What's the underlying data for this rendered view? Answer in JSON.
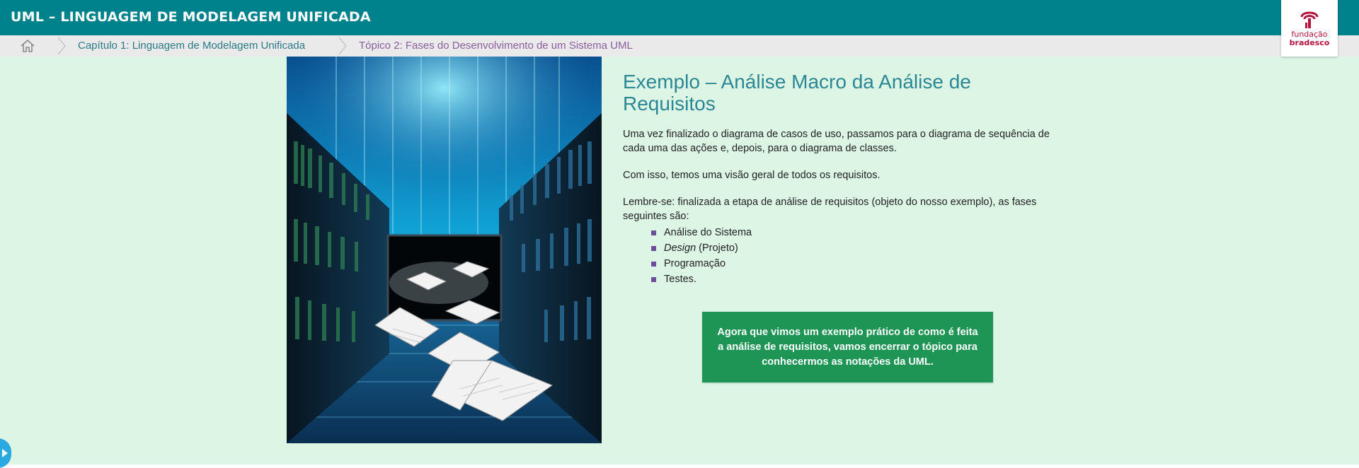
{
  "header": {
    "title": "UML – LINGUAGEM DE MODELAGEM UNIFICADA",
    "logo_line1": "fundação",
    "logo_line2": "bradesco"
  },
  "breadcrumb": {
    "items": [
      {
        "label": "Capítulo 1: Linguagem de Modelagem Unificada"
      },
      {
        "label": "Tópico 2: Fases do Desenvolvimento de um Sistema UML"
      }
    ]
  },
  "main": {
    "heading": "Exemplo – Análise Macro da Análise de Requisitos",
    "paragraphs": [
      "Uma vez finalizado o diagrama de casos de uso, passamos para o diagrama de sequência de cada uma das ações e, depois, para o diagrama de classes.",
      "Com isso, temos uma visão geral de todos os requisitos.",
      "Lembre-se: finalizada a etapa de análise de requisitos (objeto do nosso exemplo), as fases seguintes são:"
    ],
    "phases": [
      {
        "label": "Análise do Sistema"
      },
      {
        "italic": "Design",
        "label": " (Projeto)"
      },
      {
        "label": "Programação"
      },
      {
        "label": "Testes."
      }
    ],
    "callout": "Agora que vimos um exemplo prático de como é feita a análise de requisitos, vamos encerrar o tópico para conhecermos as notações da UML."
  },
  "colors": {
    "header_bg": "#00828c",
    "content_bg": "#dcf5e5",
    "callout_bg": "#1e9455",
    "bullet": "#6b4f9a",
    "brand": "#b5123e"
  },
  "icons": [
    "home-icon",
    "chevron-right-icon",
    "fundacao-bradesco-logo",
    "arrow-right-icon"
  ]
}
